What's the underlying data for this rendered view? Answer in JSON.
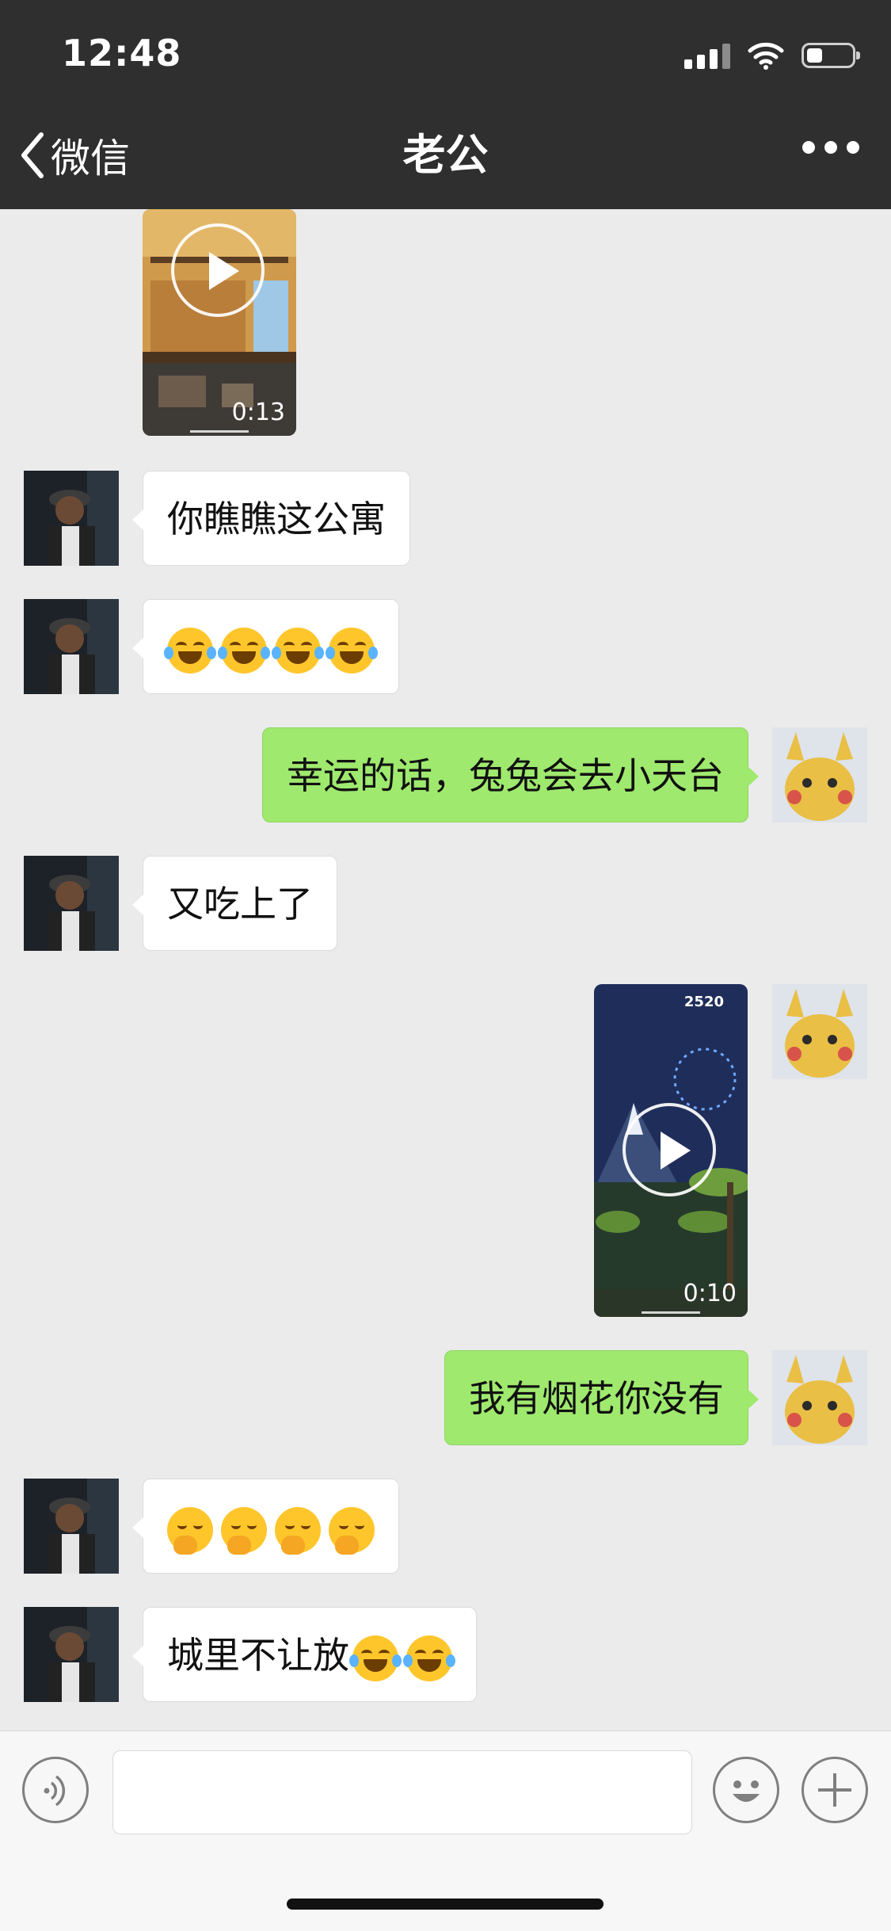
{
  "status_bar": {
    "time": "12:48",
    "battery_level": 0.35
  },
  "nav": {
    "back_label": "微信",
    "title": "老公",
    "more_icon": "ellipsis-icon"
  },
  "messages": [
    {
      "side": "left",
      "type": "video",
      "duration": "0:13"
    },
    {
      "side": "left",
      "type": "text",
      "text": "你瞧瞧这公寓"
    },
    {
      "side": "left",
      "type": "emoji",
      "emoji": "laugh-cry",
      "count": 4
    },
    {
      "side": "right",
      "type": "text",
      "text": "幸运的话，兔兔会去小天台"
    },
    {
      "side": "left",
      "type": "text",
      "text": "又吃上了"
    },
    {
      "side": "right",
      "type": "video",
      "duration": "0:10",
      "score": "2520"
    },
    {
      "side": "right",
      "type": "text",
      "text": "我有烟花你没有"
    },
    {
      "side": "left",
      "type": "emoji",
      "emoji": "giggle",
      "count": 4
    },
    {
      "side": "left",
      "type": "text",
      "text": "城里不让放",
      "trailing_emoji": "laugh-cry",
      "trailing_count": 2
    }
  ],
  "input_bar": {
    "voice_icon": "voice-icon",
    "emoji_icon": "emoji-icon",
    "add_icon": "plus-icon",
    "value": ""
  },
  "colors": {
    "nav_bg": "#2f2f2f",
    "chat_bg": "#ebebeb",
    "sent_bubble": "#9fe96e",
    "received_bubble": "#ffffff"
  }
}
